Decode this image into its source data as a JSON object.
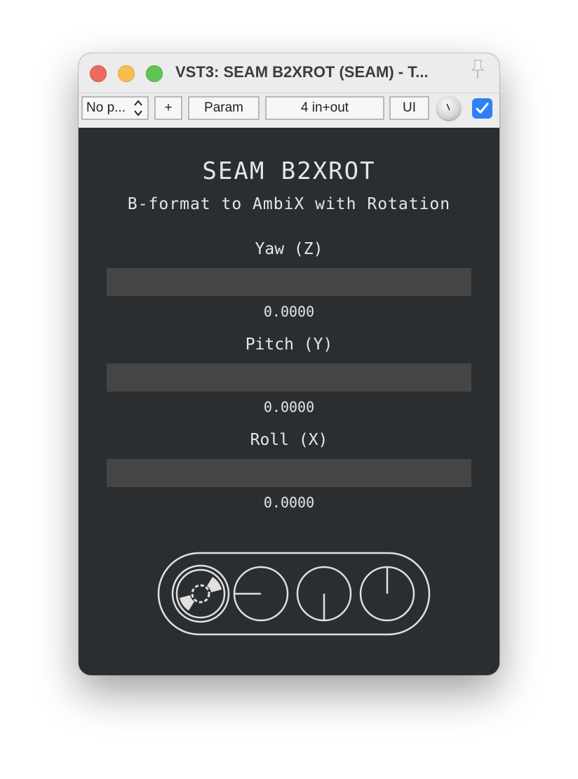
{
  "window": {
    "title": "VST3: SEAM B2XROT (SEAM) - T..."
  },
  "toolbar": {
    "preset_label": "No p...",
    "preset_arrows": "⌃⌄",
    "add_label": "+",
    "param_label": "Param",
    "io_label": "4 in+out",
    "ui_label": "UI",
    "enabled": true
  },
  "plugin": {
    "title": "SEAM B2XROT",
    "subtitle": "B-format to AmbiX with Rotation",
    "params": [
      {
        "label": "Yaw (Z)",
        "value": "0.0000",
        "fraction": 0.0
      },
      {
        "label": "Pitch (Y)",
        "value": "0.0000",
        "fraction": 0.0
      },
      {
        "label": "Roll (X)",
        "value": "0.0000",
        "fraction": 0.0
      }
    ]
  },
  "colors": {
    "panel_bg": "#2b2e31",
    "slider_track": "#454545",
    "text": "#e6e6e6",
    "checkbox": "#2f80f6"
  }
}
